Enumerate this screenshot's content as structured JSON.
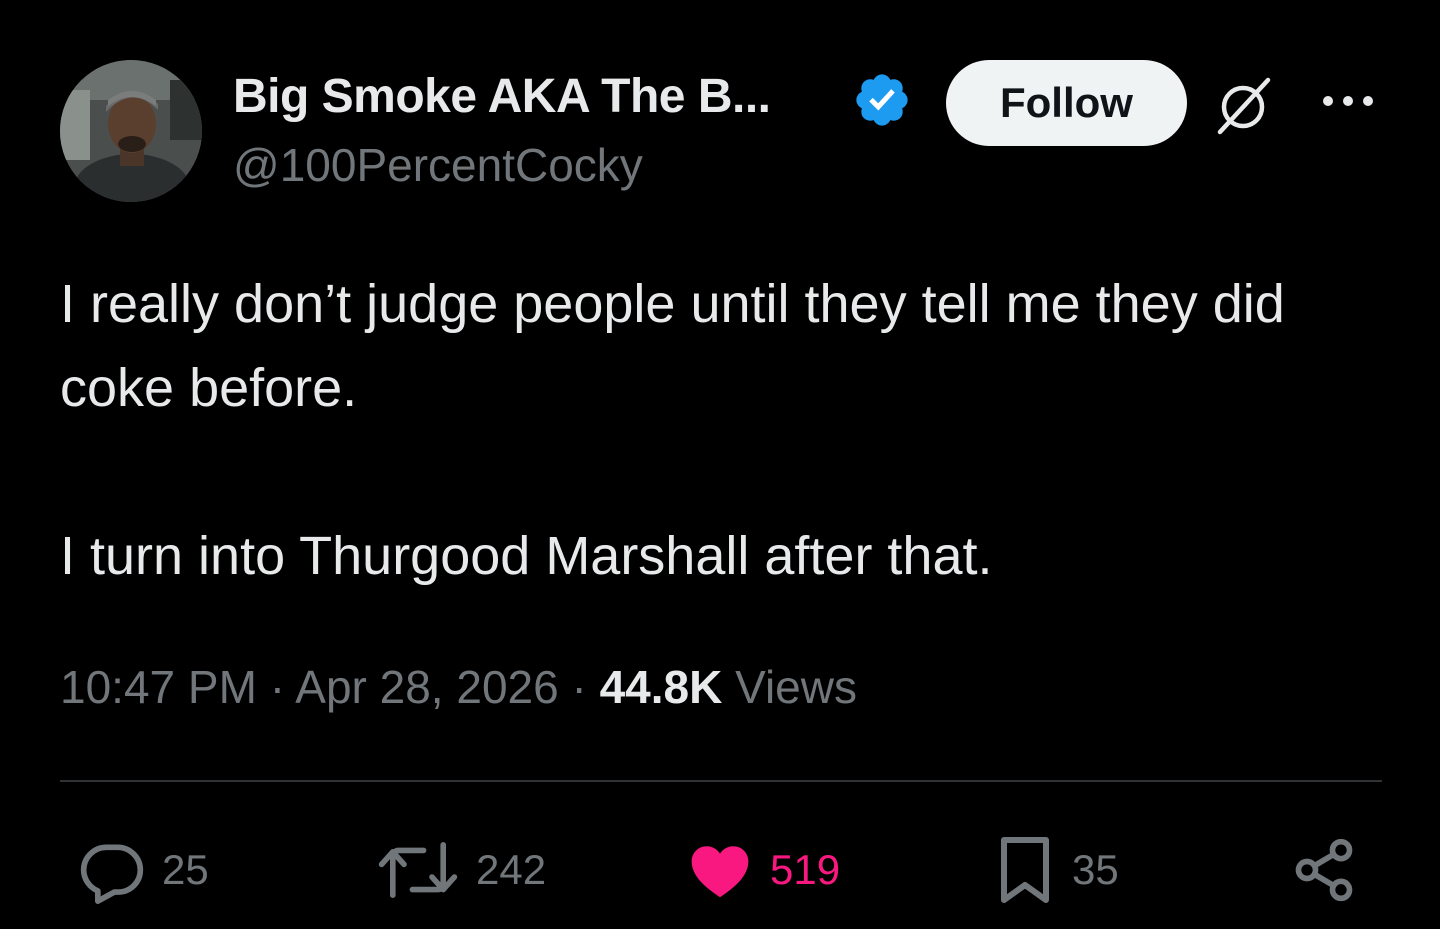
{
  "author": {
    "display_name": "Big Smoke AKA The B...",
    "handle": "@100PercentCocky",
    "verified": true
  },
  "header": {
    "follow_label": "Follow"
  },
  "tweet": {
    "text": "I really don’t judge people until they tell me they did coke before.\n\nI turn into Thurgood Marshall after that.",
    "time": "10:47 PM",
    "separator": "·",
    "date": "Apr 28, 2026",
    "views_count": "44.8K",
    "views_label": "Views"
  },
  "actions": {
    "replies": "25",
    "reposts": "242",
    "likes": "519",
    "bookmarks": "35"
  },
  "icons": [
    "verified-badge-icon",
    "grok-icon",
    "more-icon",
    "reply-icon",
    "repost-icon",
    "like-icon",
    "bookmark-icon",
    "share-icon"
  ],
  "colors": {
    "background": "#000000",
    "text_primary": "#e7e9ea",
    "text_secondary": "#71767b",
    "verified_blue": "#1d9bf0",
    "like_pink": "#f91880",
    "divider": "#2f3336",
    "follow_button_bg": "#eff3f4"
  }
}
